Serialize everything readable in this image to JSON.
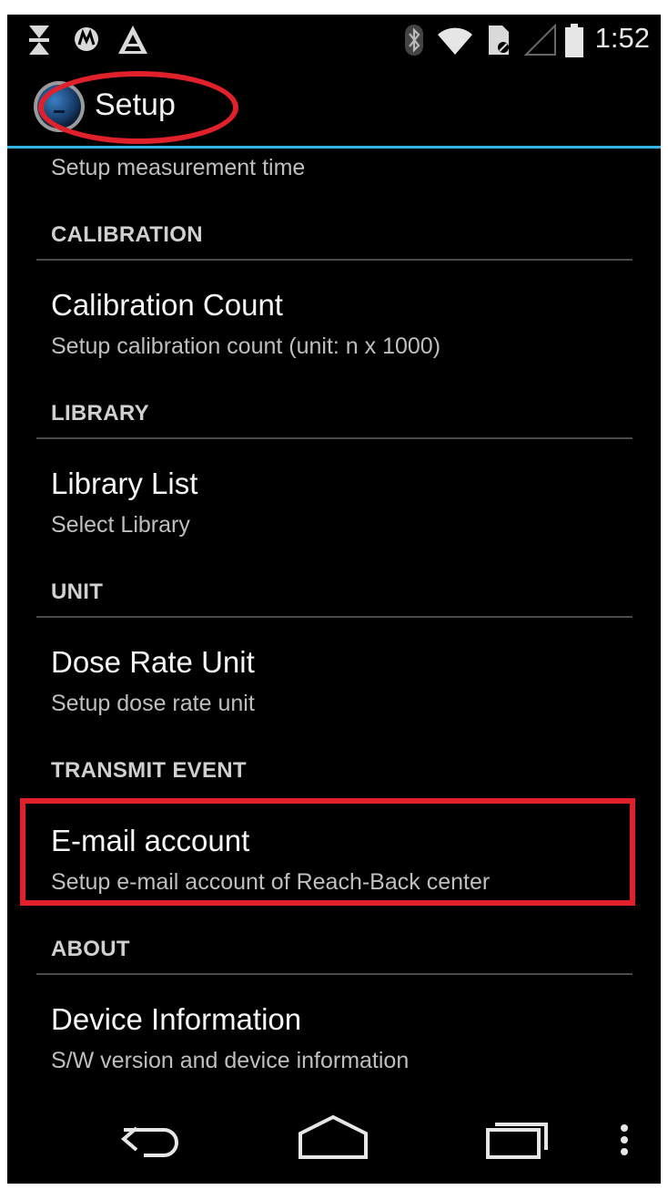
{
  "status_bar": {
    "time": "1:52",
    "left_icons": [
      "notification-icon",
      "motorola-icon",
      "alert-icon"
    ],
    "right_icons": [
      "bluetooth-icon",
      "wifi-icon",
      "sim-icon",
      "signal-icon",
      "battery-icon"
    ]
  },
  "action_bar": {
    "title": "Setup",
    "icon": "app-logo-icon"
  },
  "preferences": {
    "partial_summary": "Setup measurement time",
    "sections": [
      {
        "header": "CALIBRATION",
        "items": [
          {
            "title": "Calibration Count",
            "summary": "Setup calibration count (unit: n x 1000)"
          }
        ]
      },
      {
        "header": "LIBRARY",
        "items": [
          {
            "title": "Library List",
            "summary": "Select Library"
          }
        ]
      },
      {
        "header": "UNIT",
        "items": [
          {
            "title": "Dose Rate Unit",
            "summary": "Setup dose rate unit"
          }
        ]
      },
      {
        "header": "TRANSMIT EVENT",
        "items": [
          {
            "title": "E-mail account",
            "summary": "Setup e-mail account of Reach-Back center"
          }
        ]
      },
      {
        "header": "ABOUT",
        "items": [
          {
            "title": "Device Information",
            "summary": "S/W version and device information"
          }
        ]
      }
    ]
  },
  "nav_bar": {
    "buttons": [
      "back-icon",
      "home-icon",
      "recent-apps-icon",
      "overflow-menu-icon"
    ]
  },
  "colors": {
    "accent_line": "#33b5e5",
    "annotation_red": "#e0202a",
    "background": "#000000"
  }
}
